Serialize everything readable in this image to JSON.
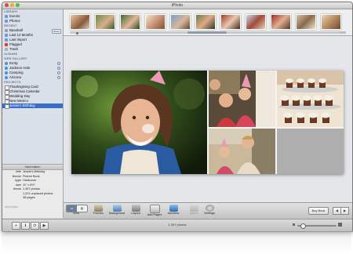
{
  "window": {
    "title": "iPhoto"
  },
  "sidebar": {
    "sections": [
      {
        "label": "LIBRARY",
        "items": [
          {
            "label": "Events",
            "icon": "events-icon"
          },
          {
            "label": "Photos",
            "icon": "photos-icon"
          }
        ]
      },
      {
        "label": "RECENT",
        "items": [
          {
            "label": "Baseball",
            "icon": "event-icon"
          },
          {
            "label": "Last 12 Months",
            "icon": "calendar-icon"
          },
          {
            "label": "Last Import",
            "icon": "import-icon"
          },
          {
            "label": "Flagged",
            "icon": "flag-icon"
          },
          {
            "label": "Trash",
            "icon": "trash-icon"
          }
        ]
      },
      {
        "label": "ALBUMS",
        "items": []
      },
      {
        "label": "WEB GALLERY",
        "items": [
          {
            "label": "Emily",
            "icon": "globe-icon"
          },
          {
            "label": "Jackson Hole",
            "icon": "globe-icon"
          },
          {
            "label": "Camping",
            "icon": "globe-icon"
          },
          {
            "label": "Arizona",
            "icon": "globe-icon"
          }
        ]
      },
      {
        "label": "PROJECTS",
        "items": [
          {
            "label": "Thanksgiving Card",
            "icon": "card-icon"
          },
          {
            "label": "Christmas Calendar",
            "icon": "calendar-icon"
          },
          {
            "label": "Wedding Day",
            "icon": "book-icon"
          },
          {
            "label": "New Mexico",
            "icon": "book-icon"
          },
          {
            "label": "Jessie's Birthday",
            "icon": "book-icon",
            "selected": true
          }
        ]
      }
    ],
    "reset_label": "Reset"
  },
  "info": {
    "header": "Information",
    "rows": [
      {
        "key": "title",
        "value": "Jessie's Birthday"
      },
      {
        "key": "theme",
        "value": "Picture Book"
      },
      {
        "key": "type",
        "value": "Hardcover"
      },
      {
        "key": "size",
        "value": "11\" x 8½\""
      },
      {
        "key": "items",
        "value": "1,397 photos"
      },
      {
        "key": "",
        "value": "1,221 unplaced photos"
      },
      {
        "key": "",
        "value": "38 pages"
      }
    ],
    "description_placeholder": "description"
  },
  "toolbar": {
    "view_label": "View",
    "buttons": [
      {
        "label": "Themes",
        "icon": "themes-icon",
        "enabled": true
      },
      {
        "label": "Background",
        "icon": "background-icon",
        "enabled": true
      },
      {
        "label": "Layout",
        "icon": "layout-icon",
        "enabled": true
      },
      {
        "label": "Add Pages",
        "icon": "add-pages-icon",
        "enabled": true
      },
      {
        "label": "Autoflow",
        "icon": "autoflow-icon",
        "enabled": true
      },
      {
        "label": "Adjust",
        "icon": "adjust-icon",
        "enabled": false
      },
      {
        "label": "Settings",
        "icon": "settings-icon",
        "enabled": true
      }
    ],
    "buy_label": "Buy Book",
    "prev_symbol": "◀",
    "next_symbol": "▶"
  },
  "bottombar": {
    "photo_count": "1,397 photos",
    "buttons": [
      "+",
      "ℹ",
      "⟳",
      "▶"
    ]
  },
  "colors": {
    "selection": "#3b6fc6",
    "sidebar_bg": "#d9e0ea",
    "canvas_bg": "#e4e6e9"
  }
}
